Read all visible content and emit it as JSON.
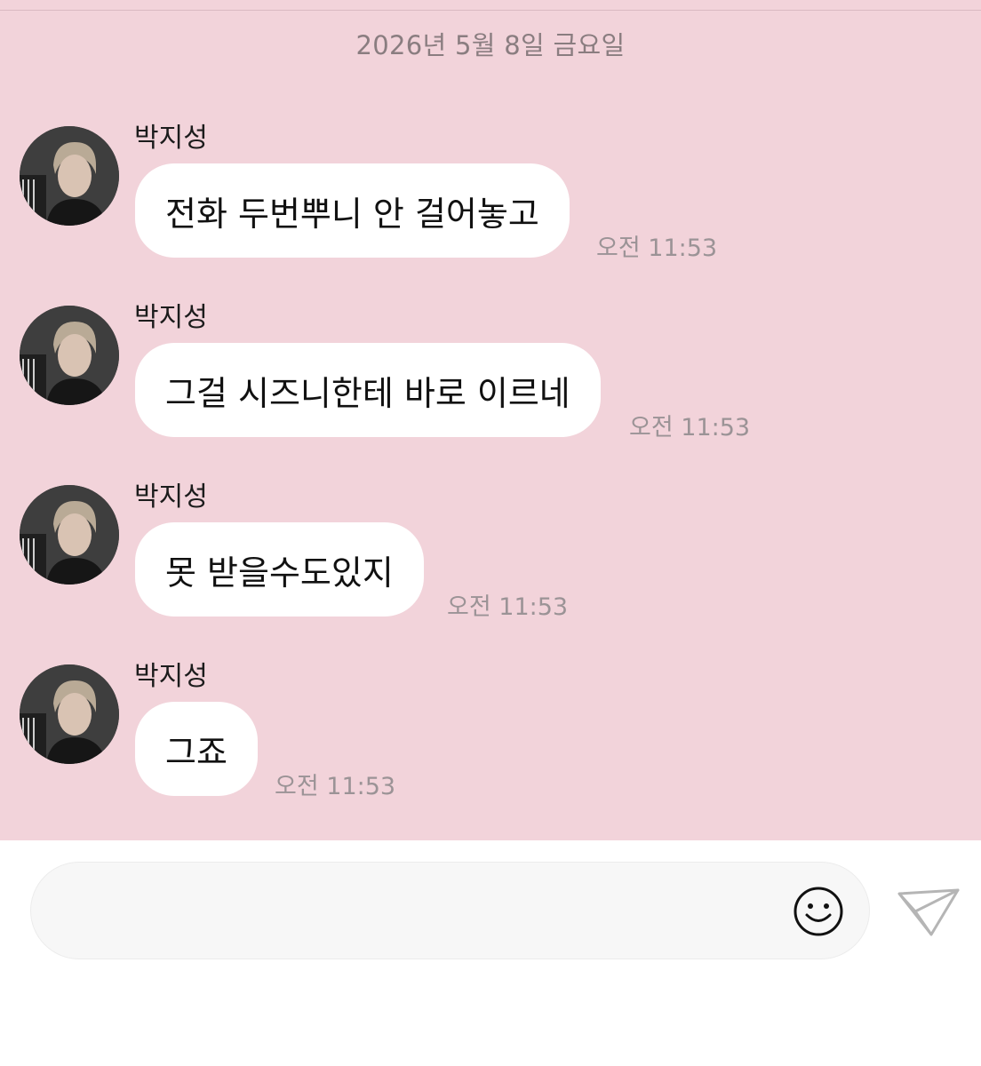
{
  "chat": {
    "date": "2026년 5월 8일 금요일",
    "messages": [
      {
        "sender": "박지성",
        "text": "전화 두번뿌니 안 걸어놓고",
        "time": "오전 11:53"
      },
      {
        "sender": "박지성",
        "text": "그걸 시즈니한테 바로 이르네",
        "time": "오전 11:53"
      },
      {
        "sender": "박지성",
        "text": "못 받을수도있지",
        "time": "오전 11:53"
      },
      {
        "sender": "박지성",
        "text": "그죠",
        "time": "오전 11:53"
      }
    ]
  },
  "composer": {
    "placeholder": "",
    "emoji_icon": "smiley-face-icon",
    "send_icon": "paper-plane-icon"
  },
  "colors": {
    "chat_background": "#f2d3da",
    "bubble": "#ffffff",
    "timestamp": "#9b9396"
  }
}
